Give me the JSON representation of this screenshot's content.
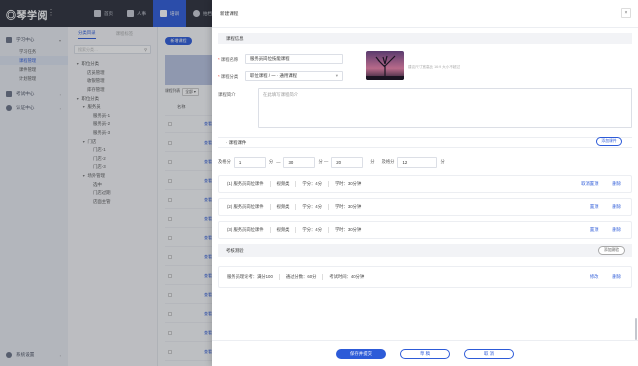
{
  "app": {
    "logo": "◎琴学阅"
  },
  "topnav": {
    "items": [
      {
        "label": "首页",
        "icon": "home-icon"
      },
      {
        "label": "人事",
        "icon": "people-icon"
      },
      {
        "label": "培训",
        "icon": "training-icon",
        "active": true
      },
      {
        "label": "拍档",
        "icon": "partner-icon"
      }
    ]
  },
  "leftbar": {
    "groups": [
      {
        "label": "学习中心",
        "icon": "study-icon",
        "subs": [
          "学习任务",
          "课程管理",
          "课件管理",
          "计划管理"
        ]
      },
      {
        "label": "考试中心",
        "icon": "exam-icon"
      },
      {
        "label": "认证中心",
        "icon": "cert-icon"
      }
    ],
    "active_sub": "课程管理",
    "bottom": "系统设置"
  },
  "catcol": {
    "tabs": [
      "分类目录",
      "课程标签"
    ],
    "search_placeholder": "搜索分类…",
    "tree": [
      {
        "label": "职位分类",
        "level": 0,
        "arrow": "▼"
      },
      {
        "label": "店员管理",
        "level": 1
      },
      {
        "label": "收银管理",
        "level": 1
      },
      {
        "label": "库存管理",
        "level": 1
      },
      {
        "label": "职位分类",
        "level": 0,
        "arrow": "▼"
      },
      {
        "label": "服务员",
        "level": 1,
        "arrow": "▼"
      },
      {
        "label": "服务员-1",
        "level": 2
      },
      {
        "label": "服务员-2",
        "level": 2
      },
      {
        "label": "服务员-3",
        "level": 2
      },
      {
        "label": "门店",
        "level": 1,
        "arrow": "▼"
      },
      {
        "label": "门店-1",
        "level": 2
      },
      {
        "label": "门店-2",
        "level": 2
      },
      {
        "label": "门店-3",
        "level": 2
      },
      {
        "label": "场外管理",
        "level": 1,
        "arrow": "▼"
      },
      {
        "label": "选中",
        "level": 2
      },
      {
        "label": "门店过期",
        "level": 2
      },
      {
        "label": "店面主管",
        "level": 2
      }
    ]
  },
  "listcol": {
    "new_button": "新增课程",
    "list_label": "课程列表",
    "filter": "全部 ▾",
    "header": "名称",
    "row_link": "查看",
    "row_count": 13
  },
  "modal": {
    "title": "新建课程",
    "close": "×",
    "section_basic": "课程信息",
    "name_label": "课程名称",
    "name_value": "服务员岗位技能课程",
    "category_label": "课程分类",
    "category_value": "职位课程 / 一 · 通用课程",
    "cover_tip": "建议尺寸宽高比 16:9 大小不超过",
    "intro_label": "课程简介",
    "intro_placeholder": "在此填写课程简介",
    "section_lessons": "· 课程课件",
    "add_lesson": "添加课件",
    "score_prefix": "及格分",
    "score_min": "1",
    "score_unit": "分",
    "score_dash": "—",
    "score_max": "30",
    "score_unit2": "分 —",
    "score_val3": "20",
    "score_unit3": "分",
    "pass_label": "及格分",
    "pass_value": "12",
    "pass_unit": "分",
    "lessons": [
      {
        "title": "(1) 服务员岗位课件",
        "type": "视频类",
        "credit": "学分：4分",
        "duration": "学时：30分钟",
        "actions": [
          "取消置顶",
          "删除"
        ]
      },
      {
        "title": "(2) 服务员岗位课件",
        "type": "视频类",
        "credit": "学分：4分",
        "duration": "学时：30分钟",
        "actions": [
          "置顶",
          "删除"
        ]
      },
      {
        "title": "(3) 服务员岗位课件",
        "type": "视频类",
        "credit": "学分：4分",
        "duration": "学时：30分钟",
        "actions": [
          "置顶",
          "删除"
        ]
      }
    ],
    "section_exam": "考核测验",
    "add_exam": "添加测验",
    "exam": {
      "title": "服务员理论考：满分100",
      "pass": "通过分数：60分",
      "time": "考试时间：40分钟",
      "actions": [
        "修改",
        "删除"
      ]
    },
    "footer": {
      "save": "保存并提交",
      "draft": "草 稿",
      "cancel": "取 消"
    }
  },
  "colors": {
    "accent": "#2d5bd8",
    "nav_bg": "#2b2f3a",
    "danger": "#e54d42"
  }
}
